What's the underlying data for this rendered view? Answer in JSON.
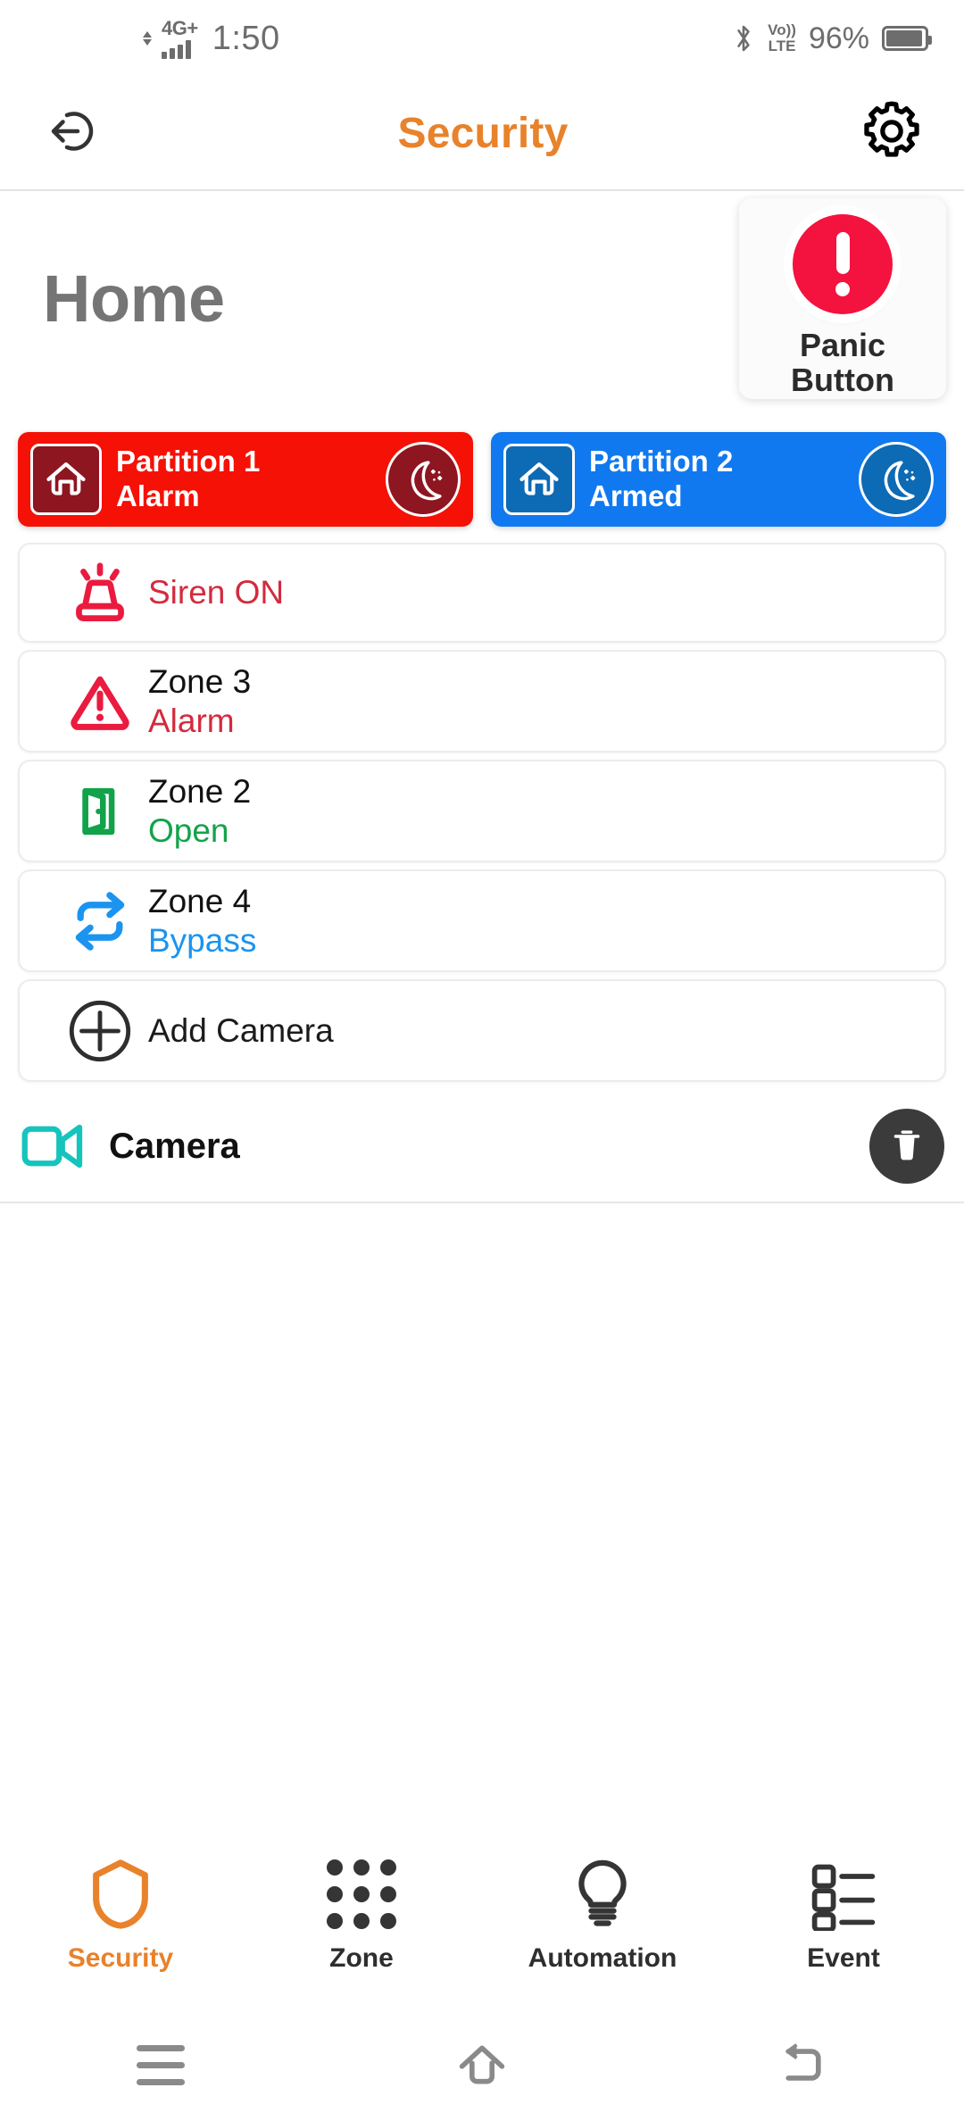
{
  "status_bar": {
    "network_label": "4G+",
    "time": "1:50",
    "volte_top": "Vo))",
    "volte_bottom": "LTE",
    "battery_percent": "96%",
    "bluetooth_icon": "bluetooth-icon",
    "signal_icon": "signal-bars-icon",
    "battery_icon": "battery-icon"
  },
  "appbar": {
    "back_icon": "back-arrow-circle-icon",
    "title": "Security",
    "settings_icon": "gear-icon",
    "title_color": "#e8822b"
  },
  "hero": {
    "page_title": "Home",
    "panic": {
      "label": "Panic Button",
      "label_line1": "Panic",
      "label_line2": "Button",
      "icon": "exclamation-circle-icon",
      "color": "#f4123f"
    }
  },
  "partitions": [
    {
      "name": "Partition 1",
      "state": "Alarm",
      "home_icon": "home-icon",
      "mode_icon": "night-moon-icon",
      "bg_color": "#f51105",
      "icon_bg_color": "#8d1620"
    },
    {
      "name": "Partition 2",
      "state": "Armed",
      "home_icon": "home-icon",
      "mode_icon": "night-moon-icon",
      "bg_color": "#1179ef",
      "icon_bg_color": "#0d6ab4"
    }
  ],
  "list": [
    {
      "icon": "siren-icon",
      "title": "Siren ON",
      "subtitle": "",
      "title_color": "#d32b3d",
      "icon_color": "#ea1b3f",
      "single_line": true
    },
    {
      "icon": "warning-triangle-icon",
      "title": "Zone 3",
      "subtitle": "Alarm",
      "subtitle_color": "#d32b3d",
      "icon_color": "#ea1b3f",
      "single_line": false
    },
    {
      "icon": "open-door-icon",
      "title": "Zone 2",
      "subtitle": "Open",
      "subtitle_color": "#12a34a",
      "icon_color": "#12a34a",
      "single_line": false
    },
    {
      "icon": "bypass-loop-icon",
      "title": "Zone 4",
      "subtitle": "Bypass",
      "subtitle_color": "#1a94ef",
      "icon_color": "#1a94ef",
      "single_line": false
    },
    {
      "icon": "plus-circle-icon",
      "title": "Add Camera",
      "subtitle": "",
      "title_color": "#1b1b1b",
      "icon_color": "#2e2e2e",
      "single_line": true
    }
  ],
  "camera": {
    "icon": "video-camera-icon",
    "icon_color": "#15c4bc",
    "name": "Camera",
    "delete_icon": "trash-icon"
  },
  "bottom_nav": [
    {
      "label": "Security",
      "icon": "shield-icon",
      "active": true,
      "color": "#e8822b"
    },
    {
      "label": "Zone",
      "icon": "grid-dots-icon",
      "active": false,
      "color": "#2e2e2e"
    },
    {
      "label": "Automation",
      "icon": "lightbulb-icon",
      "active": false,
      "color": "#2e2e2e"
    },
    {
      "label": "Event",
      "icon": "list-checklist-icon",
      "active": false,
      "color": "#2e2e2e"
    }
  ],
  "android_nav": {
    "recents_icon": "menu-hamburger-icon",
    "home_icon": "home-outline-icon",
    "back_icon": "back-curved-arrow-icon"
  }
}
